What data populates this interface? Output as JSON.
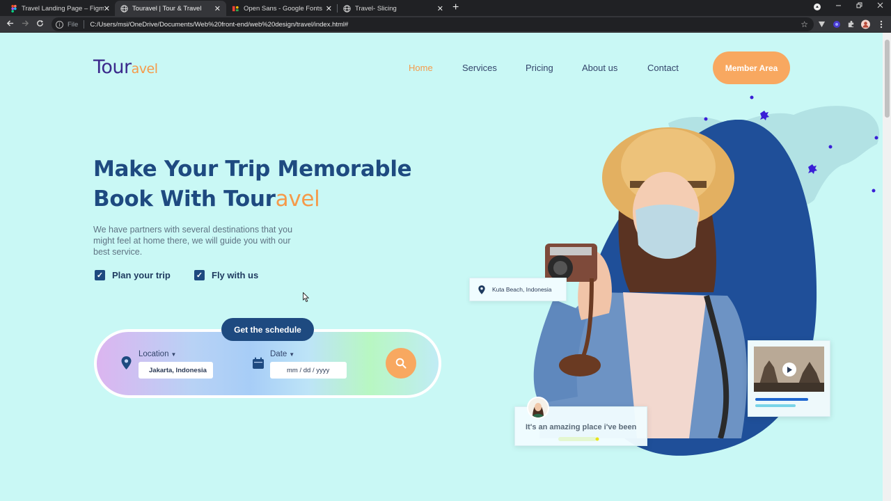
{
  "browser": {
    "tabs": [
      {
        "title": "Travel Landing Page – Figma",
        "icon": "figma-icon",
        "active": false
      },
      {
        "title": "Touravel | Tour & Travel",
        "icon": "globe-icon",
        "active": true
      },
      {
        "title": "Open Sans - Google Fonts",
        "icon": "google-fonts-icon",
        "active": false
      },
      {
        "title": "Travel- Slicing",
        "icon": "globe-icon",
        "active": false
      }
    ],
    "close_glyph": "✕",
    "new_tab_glyph": "+",
    "address": {
      "scheme_label": "File",
      "url": "C:/Users/msi/OneDrive/Documents/Web%20front-end/web%20design/travel/index.html#"
    }
  },
  "site": {
    "logo": {
      "main": "Tour",
      "accent": "avel"
    },
    "nav": [
      {
        "label": "Home",
        "active": true
      },
      {
        "label": "Services",
        "active": false
      },
      {
        "label": "Pricing",
        "active": false
      },
      {
        "label": "About us",
        "active": false
      },
      {
        "label": "Contact",
        "active": false
      }
    ],
    "member_button": "Member Area"
  },
  "hero": {
    "headline_line1": "Make Your Trip Memorable",
    "headline_line2_main": "Book With Tour",
    "headline_line2_accent": "avel",
    "description": "We have partners with several destinations that you might feel at home there, we will guide you with our best service.",
    "checks": [
      {
        "label": "Plan your trip",
        "checked": true
      },
      {
        "label": "Fly with us",
        "checked": true
      }
    ]
  },
  "booking": {
    "schedule_button": "Get the schedule",
    "location_label": "Location",
    "location_value": "Jakarta, Indonesia",
    "date_label": "Date",
    "date_placeholder": "mm / dd / yyyy"
  },
  "cards": {
    "location_card": "Kuta Beach, Indonesia",
    "review_quote": "It's an amazing place i've been"
  },
  "colors": {
    "background": "#c9f8f5",
    "primary": "#1e4a80",
    "accent": "#f59a4a",
    "button_orange": "#f8a860",
    "logo_purple": "#3b2a8c"
  }
}
